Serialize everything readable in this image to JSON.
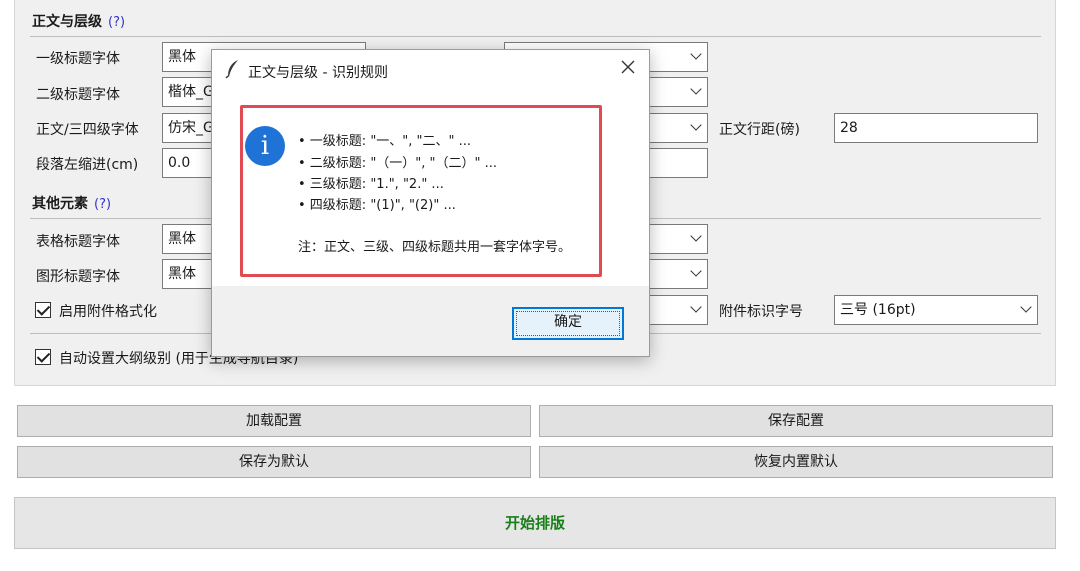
{
  "sections": {
    "body_levels": {
      "title": "正文与层级",
      "help": "(?)"
    },
    "other": {
      "title": "其他元素",
      "help": "(?)"
    }
  },
  "fields": {
    "h1_font_label": "一级标题字体",
    "h1_font_value": "黑体",
    "h2_font_label": "二级标题字体",
    "h2_font_value": "楷体_G",
    "body_font_label": "正文/三四级字体",
    "body_font_value": "仿宋_G",
    "indent_label": "段落左缩进(cm)",
    "indent_value": "0.0",
    "line_spacing_label": "正文行距(磅)",
    "line_spacing_value": "28",
    "table_title_label": "表格标题字体",
    "table_title_value": "黑体",
    "figure_title_label": "图形标题字体",
    "figure_title_value": "黑体",
    "attachment_label": "启用附件格式化",
    "attachment_size_label": "附件标识字号",
    "attachment_size_value": "三号 (16pt)",
    "outline_label": "自动设置大纲级别 (用于生成导航目录)"
  },
  "buttons": {
    "load": "加载配置",
    "save": "保存配置",
    "save_default": "保存为默认",
    "restore_default": "恢复内置默认",
    "start": "开始排版"
  },
  "dialog": {
    "title": "正文与层级 - 识别规则",
    "rules": [
      "• 一级标题: \"一、\", \"二、\" ...",
      "• 二级标题: \"（一）\", \"（二）\" ...",
      "• 三级标题: \"1.\", \"2.\" ...",
      "• 四级标题: \"(1)\", \"(2)\" ..."
    ],
    "note": "注：正文、三级、四级标题共用一套字体字号。",
    "ok": "确定"
  },
  "colors": {
    "accent": "#0078d7",
    "highlight": "#e04a52",
    "start_text": "#1a7f1a",
    "info_icon": "#1f72d6"
  }
}
